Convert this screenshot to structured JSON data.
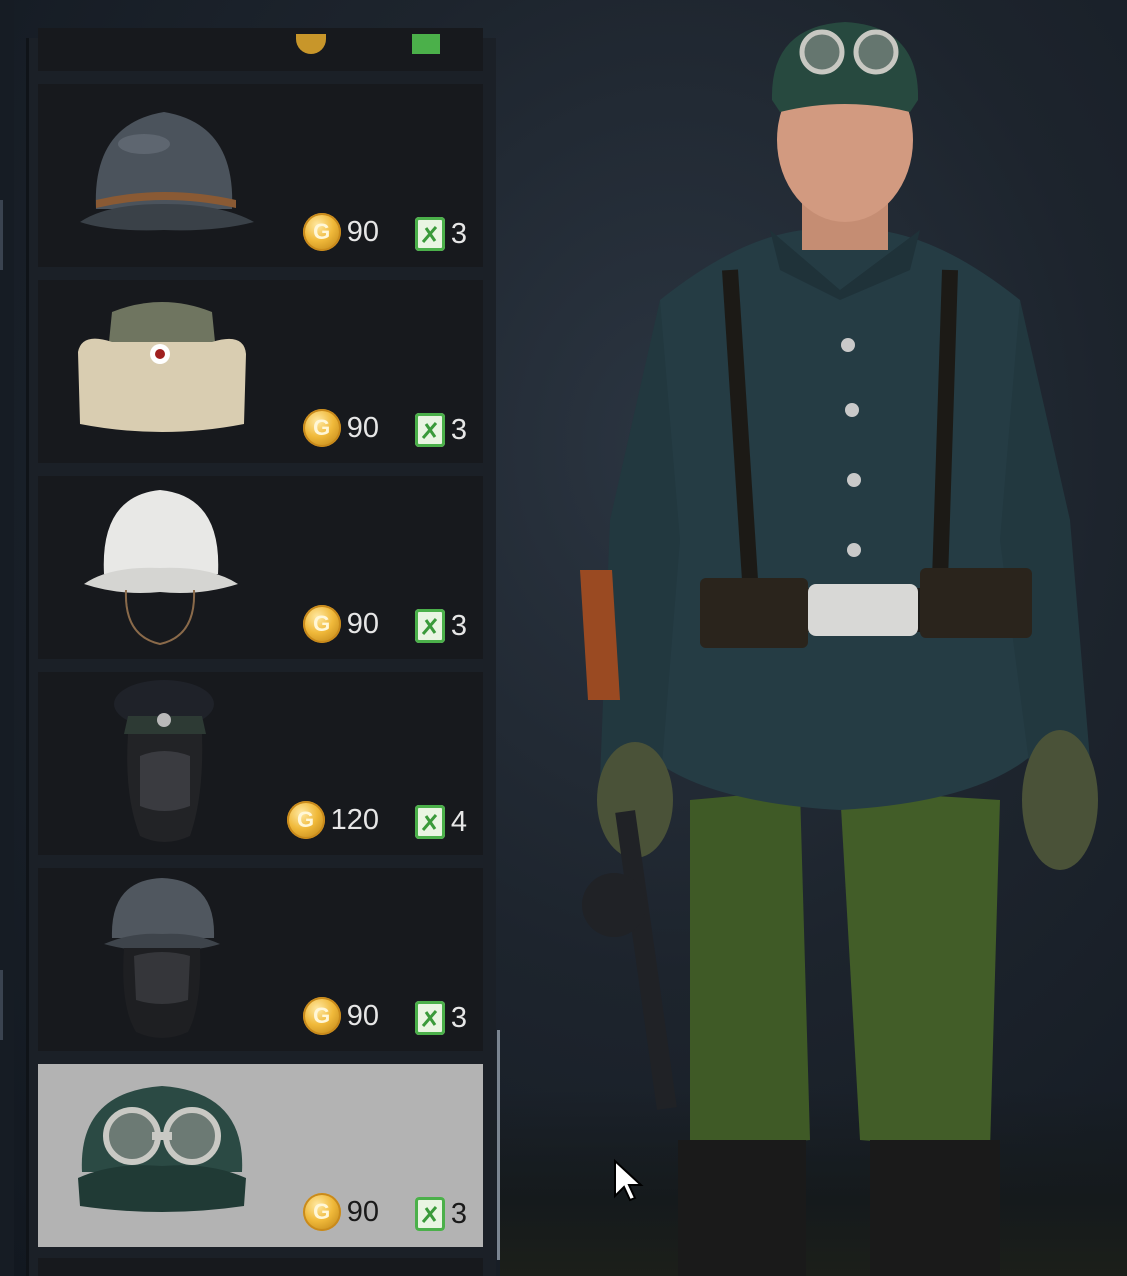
{
  "inventory": {
    "items": [
      {
        "name": "steel-helmet-with-scrim",
        "price": "90",
        "tokens": "3",
        "selected": false
      },
      {
        "name": "side-cap-with-fur",
        "price": "90",
        "tokens": "3",
        "selected": false
      },
      {
        "name": "white-covered-helmet",
        "price": "90",
        "tokens": "3",
        "selected": false
      },
      {
        "name": "officer-cap-with-balaclava",
        "price": "120",
        "tokens": "4",
        "selected": false
      },
      {
        "name": "helmet-with-balaclava",
        "price": "90",
        "tokens": "3",
        "selected": false
      },
      {
        "name": "cap-with-goggles",
        "price": "90",
        "tokens": "3",
        "selected": true
      }
    ],
    "coin_symbol": "G"
  },
  "colors": {
    "card_bg": "#17191d",
    "card_selected_bg": "#b3b3b3",
    "coin_gold": "#f0b93a",
    "token_green": "#4bb04a"
  }
}
